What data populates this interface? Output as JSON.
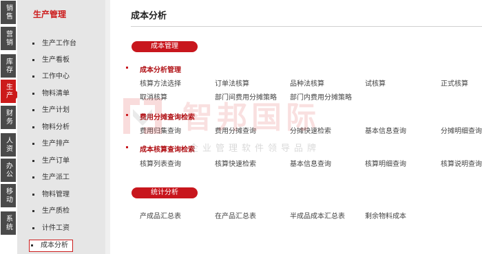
{
  "modules": [
    {
      "label": "销售",
      "active": false
    },
    {
      "label": "营销",
      "active": false
    },
    {
      "label": "库存",
      "active": false
    },
    {
      "label": "生产",
      "active": true
    },
    {
      "label": "财务",
      "active": false
    },
    {
      "label": "人资",
      "active": false
    },
    {
      "label": "办公",
      "active": false
    },
    {
      "label": "移动",
      "active": false
    },
    {
      "label": "系统",
      "active": false
    }
  ],
  "submenu": {
    "title": "生产管理",
    "items": [
      "生产工作台",
      "生产看板",
      "工作中心",
      "物料清单",
      "生产计划",
      "物料分析",
      "生产排产",
      "生产订单",
      "生产派工",
      "物料管理",
      "生产质检",
      "计件工资",
      "成本分析"
    ],
    "current": "成本分析"
  },
  "main": {
    "title": "成本分析",
    "groups": [
      {
        "pill": "成本管理",
        "sections": [
          {
            "title": "成本分析管理",
            "links": [
              "核算方法选择",
              "订单法核算",
              "品种法核算",
              "试核算",
              "正式核算",
              "取消核算",
              "部门间费用分摊策略",
              "部门内费用分摊策略"
            ]
          },
          {
            "title": "费用分摊查询检索",
            "links": [
              "费用归集查询",
              "费用分摊查询",
              "分摊快速检索",
              "基本信息查询",
              "分摊明细查询"
            ]
          },
          {
            "title": "成本核算查询检索",
            "links": [
              "核算列表查询",
              "核算快速检索",
              "基本信息查询",
              "核算明细查询",
              "核算说明查询"
            ]
          }
        ]
      },
      {
        "pill": "统计分析",
        "sections": [
          {
            "title": "",
            "links": [
              "产成品汇总表",
              "在产品汇总表",
              "半成品成本汇总表",
              "剩余物料成本"
            ]
          }
        ]
      }
    ]
  },
  "watermark": {
    "brand": "智邦国际",
    "slogan": "企业管理软件领导品牌"
  },
  "colors": {
    "accent": "#c8161d",
    "module_bg": "#4a4a4a",
    "submenu_bg": "#e6e6e6"
  }
}
